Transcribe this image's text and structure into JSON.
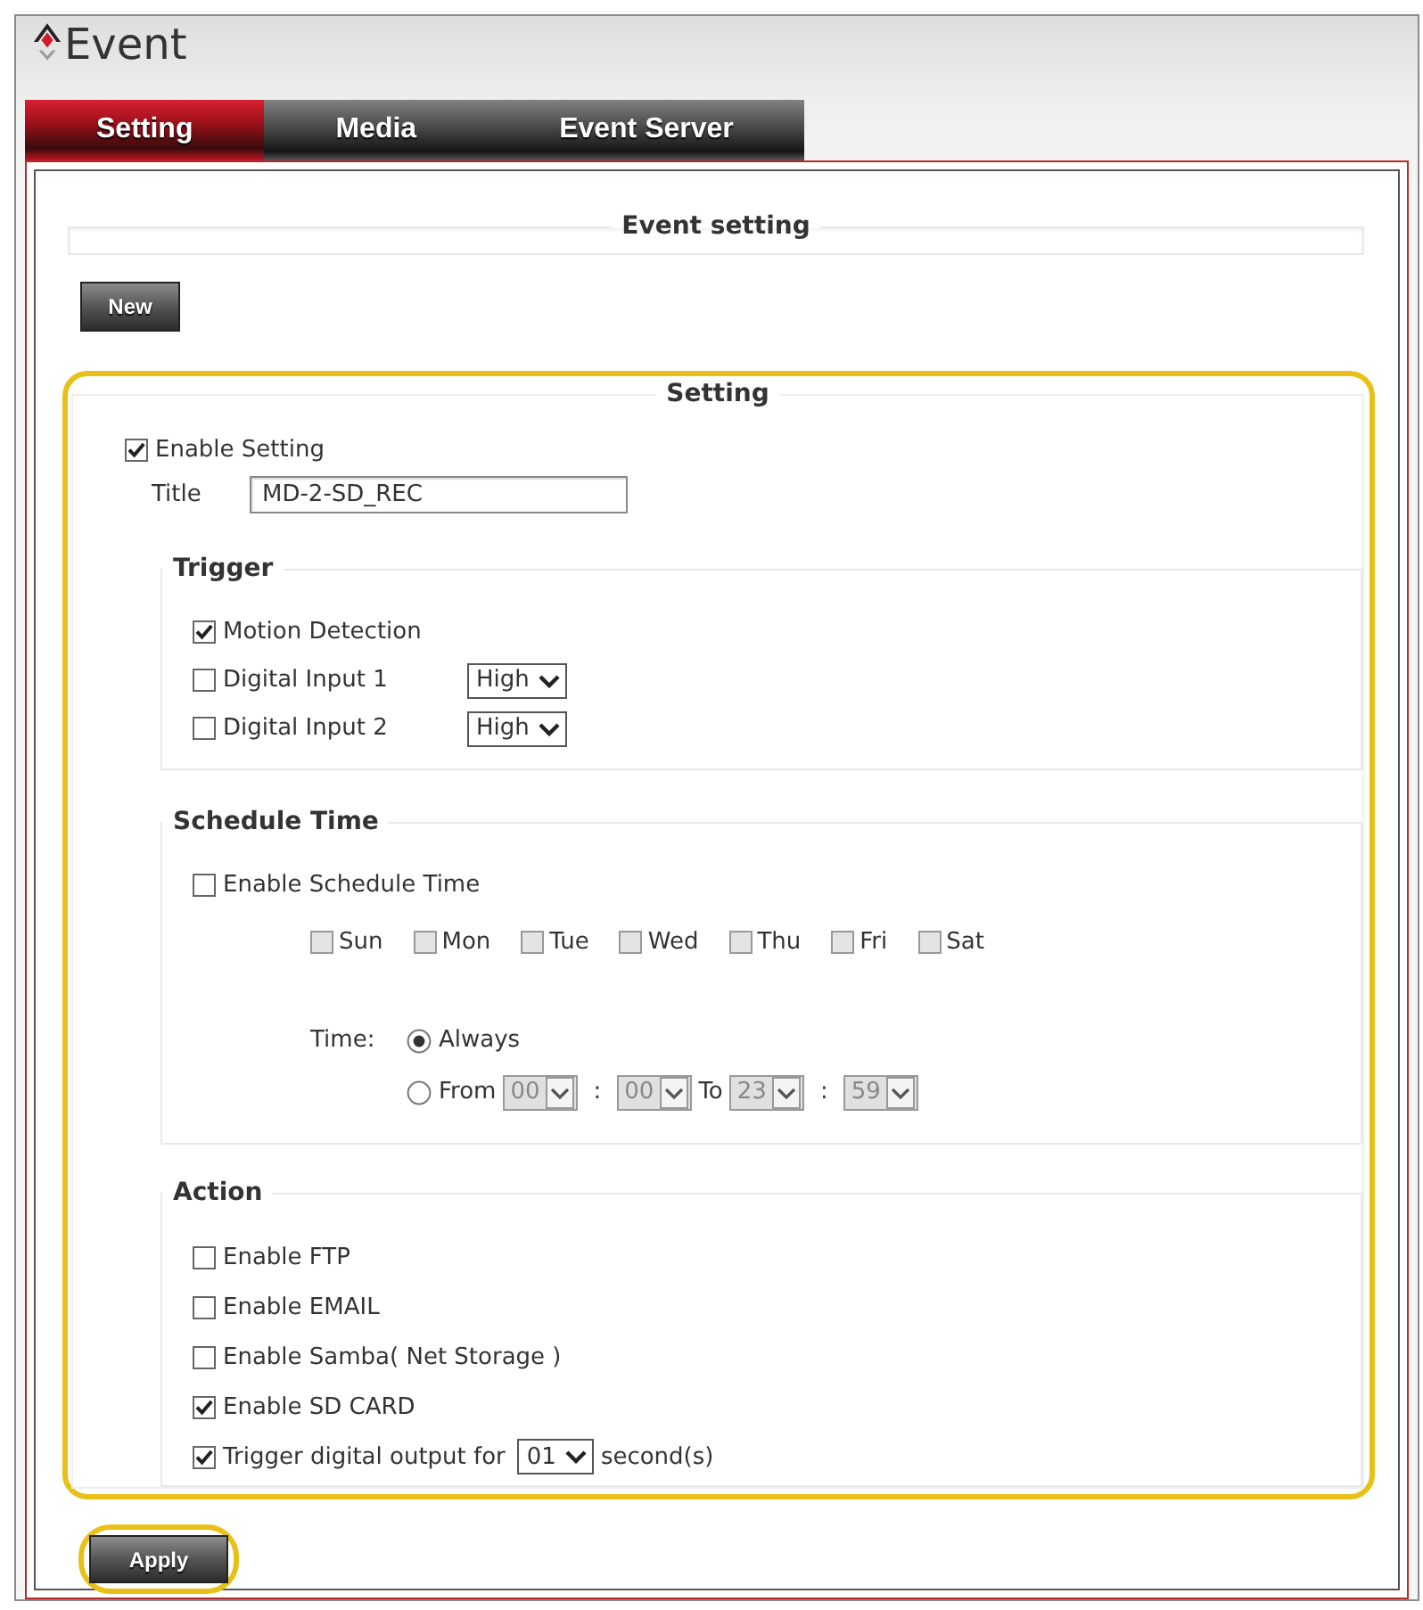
{
  "window": {
    "title": "Event"
  },
  "tabs": [
    {
      "label": "Setting",
      "selected": true
    },
    {
      "label": "Media",
      "selected": false
    },
    {
      "label": "Event Server",
      "selected": false
    }
  ],
  "event_setting": {
    "legend": "Event setting"
  },
  "new_button": {
    "label": "New"
  },
  "setting": {
    "legend": "Setting",
    "highlighted": true,
    "enable": {
      "label": "Enable Setting",
      "checked": true
    },
    "title": {
      "label": "Title",
      "value": "MD-2-SD_REC"
    },
    "trigger": {
      "legend": "Trigger",
      "items": [
        {
          "kind": "plain",
          "label": "Motion Detection",
          "checked": true
        },
        {
          "kind": "level",
          "label": "Digital Input 1",
          "checked": false,
          "select": "High"
        },
        {
          "kind": "level",
          "label": "Digital Input 2",
          "checked": false,
          "select": "High"
        }
      ]
    },
    "schedule": {
      "legend": "Schedule Time",
      "enable": {
        "label": "Enable Schedule Time",
        "checked": false
      },
      "days": [
        {
          "label": "Sun",
          "checked": false,
          "disabled": true
        },
        {
          "label": "Mon",
          "checked": false,
          "disabled": true
        },
        {
          "label": "Tue",
          "checked": false,
          "disabled": true
        },
        {
          "label": "Wed",
          "checked": false,
          "disabled": true
        },
        {
          "label": "Thu",
          "checked": false,
          "disabled": true
        },
        {
          "label": "Fri",
          "checked": false,
          "disabled": true
        },
        {
          "label": "Sat",
          "checked": false,
          "disabled": true
        }
      ],
      "time": {
        "label": "Time:",
        "options": [
          {
            "kind": "always",
            "label": "Always",
            "selected": true
          },
          {
            "kind": "range",
            "label": "From",
            "selected": false,
            "disabled": true,
            "from": {
              "hour": "00",
              "separator": ":",
              "minute": "00"
            },
            "to_label": "To",
            "to": {
              "hour": "23",
              "separator": ":",
              "minute": "59"
            }
          }
        ]
      }
    },
    "action": {
      "legend": "Action",
      "items": [
        {
          "kind": "plain",
          "label": "Enable FTP",
          "checked": false
        },
        {
          "kind": "plain",
          "label": "Enable EMAIL",
          "checked": false
        },
        {
          "kind": "plain",
          "label": "Enable Samba( Net Storage )",
          "checked": false
        },
        {
          "kind": "plain",
          "label": "Enable SD CARD",
          "checked": true
        },
        {
          "kind": "duration",
          "label": "Trigger digital output for",
          "checked": true,
          "select": "01",
          "suffix": "second(s)"
        }
      ]
    }
  },
  "apply_button": {
    "label": "Apply",
    "highlighted": true
  }
}
